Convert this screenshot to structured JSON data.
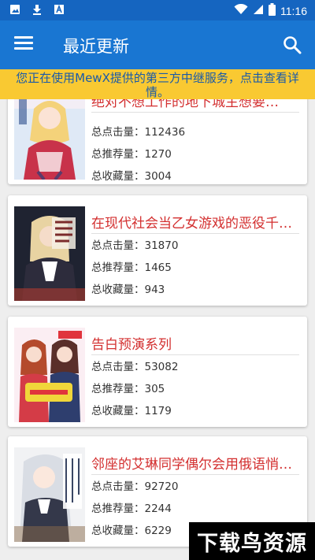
{
  "status_bar": {
    "time": "11:16",
    "icons": [
      "image-icon",
      "download-icon",
      "a-box-icon",
      "wifi-icon",
      "signal-icon",
      "battery-icon"
    ]
  },
  "app_bar": {
    "title": "最近更新",
    "menu_icon": "menu-icon",
    "search_icon": "search-icon"
  },
  "notice": {
    "text": "您正在使用MewX提供的第三方中继服务，点击查看详情。"
  },
  "labels": {
    "clicks": "总点击量：",
    "recommends": "总推荐量：",
    "favorites": "总收藏量："
  },
  "novels": [
    {
      "title": "绝对不想工作的地下城主想要…",
      "clicks": "112436",
      "recommends": "1270",
      "favorites": "3004"
    },
    {
      "title": "在现代社会当乙女游戏的恶役千…",
      "clicks": "31870",
      "recommends": "1465",
      "favorites": "943"
    },
    {
      "title": "告白预演系列",
      "clicks": "53082",
      "recommends": "305",
      "favorites": "1179"
    },
    {
      "title": "邻座的艾琳同学偶尔会用俄语悄…",
      "clicks": "92720",
      "recommends": "2244",
      "favorites": "6229"
    }
  ],
  "watermark": "下载鸟资源",
  "colors": {
    "status_bar": "#1565c0",
    "app_bar": "#1976d2",
    "notice_bg": "#f9c932",
    "notice_text": "#1a5aa8",
    "title_red": "#d32f2f"
  }
}
